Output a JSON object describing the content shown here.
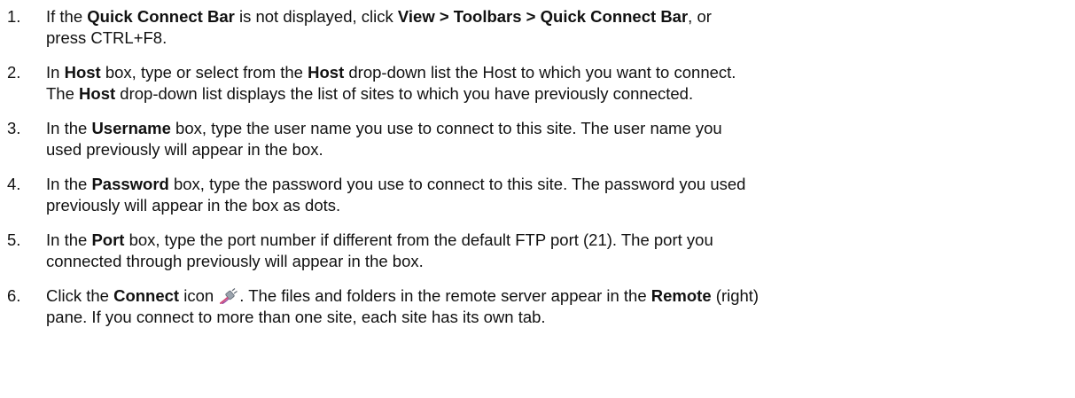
{
  "steps": [
    {
      "number": "1.",
      "t1": "If the ",
      "b1": "Quick Connect Bar",
      "t2": " is not displayed, click ",
      "b2": "View > Toolbars > Quick Connect Bar",
      "t3": ", or",
      "t4": "press CTRL+F8."
    },
    {
      "number": "2.",
      "t1": "In ",
      "b1": "Host",
      "t2": " box, type or select from the ",
      "b2": "Host",
      "t3": " drop-down list the Host to which you want to connect.",
      "t4": "The ",
      "b3": "Host",
      "t5": " drop-down list displays the list of sites to which you have previously connected."
    },
    {
      "number": "3.",
      "t1": "In the ",
      "b1": "Username",
      "t2": " box, type the user name you use to connect to this site. The user name you",
      "t3": "used previously will appear in the box."
    },
    {
      "number": "4.",
      "t1": "In the ",
      "b1": "Password",
      "t2": " box, type the password you use to connect to this site. The password you used",
      "t3": "previously will appear in the box as dots."
    },
    {
      "number": "5.",
      "t1": "In the ",
      "b1": "Port",
      "t2": " box, type the port number if different from the default FTP port (21). The port you",
      "t3": "connected through previously will appear in the box."
    },
    {
      "number": "6.",
      "t1": "Click the ",
      "b1": "Connect",
      "t2": " icon ",
      "t3": ". The files and folders in the remote server appear in the ",
      "b2": "Remote",
      "t4": " (right)",
      "t5": "pane. If you connect to more than one site, each site has its own tab."
    }
  ],
  "icons": {
    "connect": "connect-plug-icon"
  },
  "colors": {
    "text": "#111111",
    "background": "#ffffff"
  }
}
